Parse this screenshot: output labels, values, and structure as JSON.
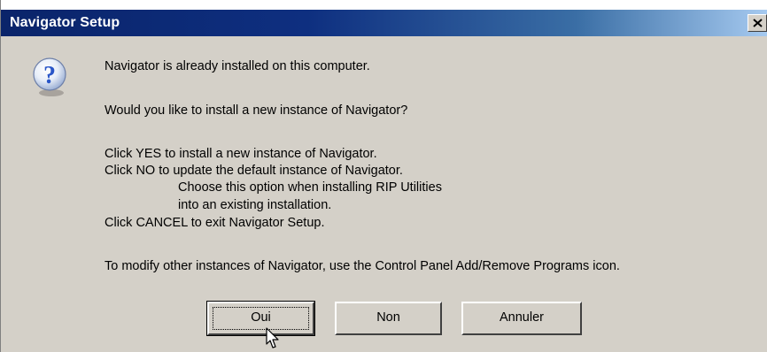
{
  "window": {
    "title": "Navigator Setup",
    "close_symbol": "×"
  },
  "icon": {
    "name": "question-icon",
    "glyph": "?",
    "color": "#2a56c8"
  },
  "message": {
    "line1": "Navigator is already installed on this computer.",
    "line2": "Would you like to install a new instance of Navigator?",
    "line3": "Click YES to install a new instance of Navigator.",
    "line4": "Click NO to update the default instance of Navigator.",
    "line5": "Choose this option when installing RIP Utilities",
    "line6": "into an existing installation.",
    "line7": "Click CANCEL to exit Navigator Setup.",
    "line8": "To modify other instances of Navigator, use the Control Panel Add/Remove Programs icon."
  },
  "buttons": {
    "yes": "Oui",
    "no": "Non",
    "cancel": "Annuler"
  }
}
